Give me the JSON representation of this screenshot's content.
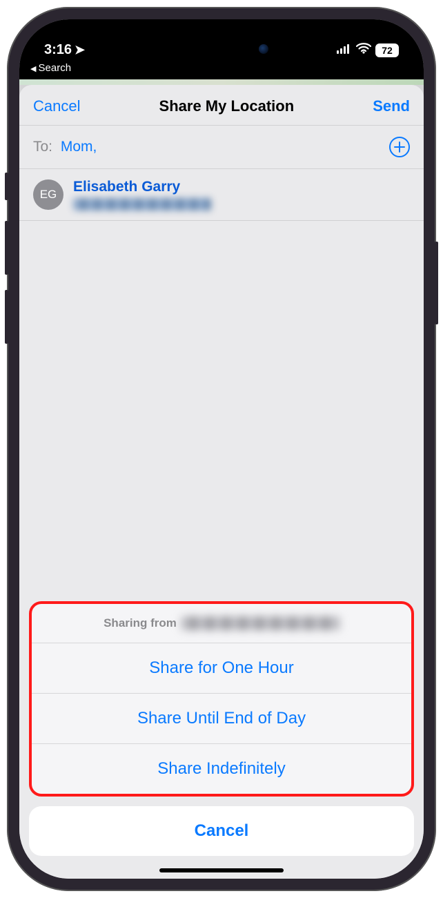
{
  "status": {
    "time": "3:16",
    "back_label": "Search",
    "battery": "72"
  },
  "sheet": {
    "cancel": "Cancel",
    "title": "Share My Location",
    "send": "Send",
    "to_label": "To:",
    "to_value": "Mom,",
    "contact": {
      "initials": "EG",
      "name": "Elisabeth Garry"
    }
  },
  "action_sheet": {
    "header_prefix": "Sharing from",
    "options": [
      "Share for One Hour",
      "Share Until End of Day",
      "Share Indefinitely"
    ],
    "cancel": "Cancel"
  }
}
